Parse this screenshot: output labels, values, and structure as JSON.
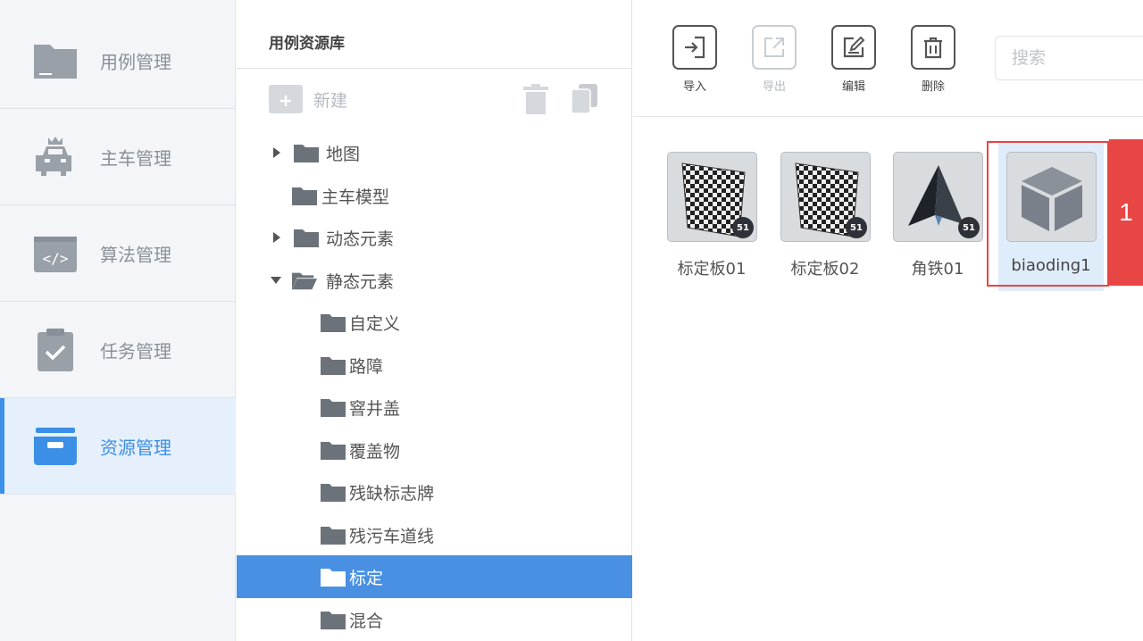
{
  "nav": {
    "items": [
      {
        "label": "用例管理",
        "icon": "folder-icon",
        "active": false
      },
      {
        "label": "主车管理",
        "icon": "car-icon",
        "active": false
      },
      {
        "label": "算法管理",
        "icon": "code-icon",
        "active": false
      },
      {
        "label": "任务管理",
        "icon": "task-icon",
        "active": false
      },
      {
        "label": "资源管理",
        "icon": "drawer-icon",
        "active": true
      }
    ],
    "active_color": "#3c8fe6"
  },
  "tree": {
    "title": "用例资源库",
    "new_label": "新建",
    "nodes": [
      {
        "label": "地图",
        "expandable": true,
        "expanded": false,
        "level": 0
      },
      {
        "label": "主车模型",
        "expandable": false,
        "level": 0
      },
      {
        "label": "动态元素",
        "expandable": true,
        "expanded": false,
        "level": 0
      },
      {
        "label": "静态元素",
        "expandable": true,
        "expanded": true,
        "level": 0
      },
      {
        "label": "自定义",
        "level": 1
      },
      {
        "label": "路障",
        "level": 1
      },
      {
        "label": "窨井盖",
        "level": 1
      },
      {
        "label": "覆盖物",
        "level": 1
      },
      {
        "label": "残缺标志牌",
        "level": 1
      },
      {
        "label": "残污车道线",
        "level": 1
      },
      {
        "label": "标定",
        "level": 1,
        "selected": true
      },
      {
        "label": "混合",
        "level": 1
      }
    ],
    "selected_color": "#4a90e2"
  },
  "toolbar": {
    "import_label": "导入",
    "export_label": "导出",
    "edit_label": "编辑",
    "delete_label": "删除",
    "search_placeholder": "搜索"
  },
  "assets": [
    {
      "label": "标定板01",
      "thumb": "checkerboard",
      "badge": "51"
    },
    {
      "label": "标定板02",
      "thumb": "checkerboard",
      "badge": "51"
    },
    {
      "label": "角铁01",
      "thumb": "pyramid",
      "badge": "51"
    },
    {
      "label": "biaoding1",
      "thumb": "cube",
      "selected": true
    }
  ],
  "annotation": {
    "step": "1",
    "color": "#e84545"
  }
}
